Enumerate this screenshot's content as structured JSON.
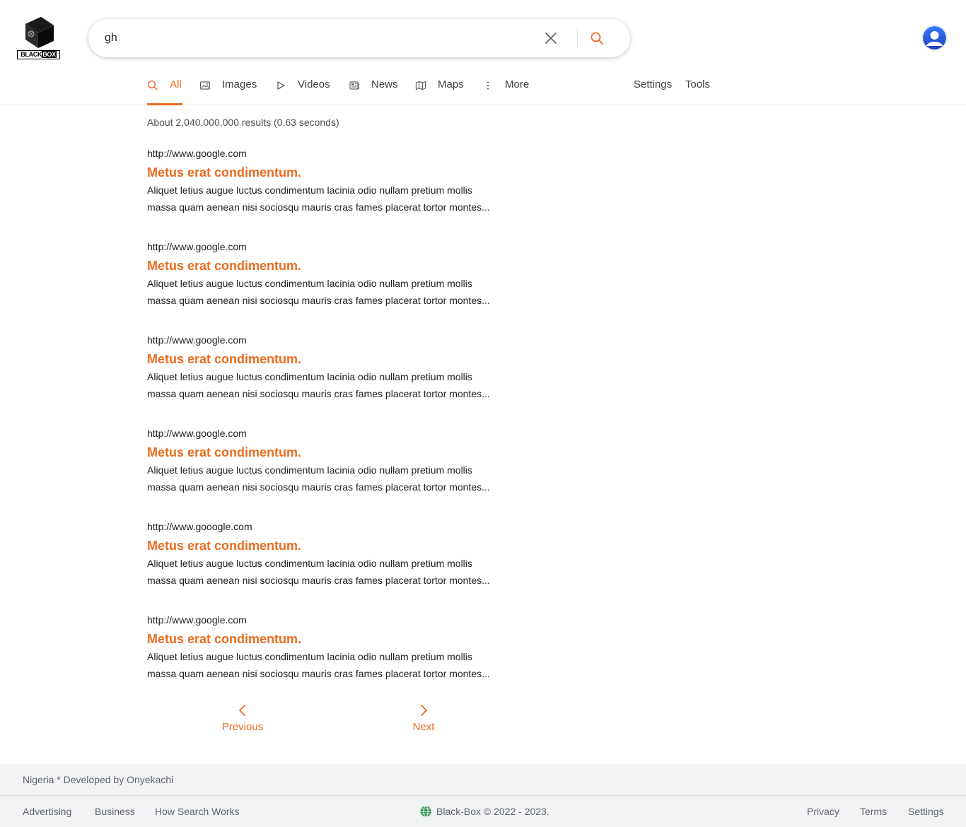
{
  "brand": {
    "logo_left": "BLACK",
    "logo_right": "BOX"
  },
  "search": {
    "query": "gh",
    "clear_icon": "close-icon",
    "search_icon": "search-icon"
  },
  "user": {
    "avatar_icon": "user-avatar-icon"
  },
  "tabs": [
    {
      "label": "All",
      "icon": "search-icon",
      "active": true
    },
    {
      "label": "Images",
      "icon": "image-icon",
      "active": false
    },
    {
      "label": "Videos",
      "icon": "play-icon",
      "active": false
    },
    {
      "label": "News",
      "icon": "newspaper-icon",
      "active": false
    },
    {
      "label": "Maps",
      "icon": "map-icon",
      "active": false
    },
    {
      "label": "More",
      "icon": "more-vert-icon",
      "active": false
    }
  ],
  "tools": {
    "settings": "Settings",
    "tools": "Tools"
  },
  "results_stats": "About 2,040,000,000 results (0.63 seconds)",
  "results": [
    {
      "url": "http://www.google.com",
      "title": "Metus erat condimentum.",
      "snippet_line1": "Aliquet letius augue luctus condimentum lacinia odio nullam pretium mollis",
      "snippet_line2": "massa quam aenean nisi sociosqu mauris cras fames placerat tortor montes..."
    },
    {
      "url": "http://www.google.com",
      "title": "Metus erat condimentum.",
      "snippet_line1": "Aliquet letius augue luctus condimentum lacinia odio nullam pretium mollis",
      "snippet_line2": "massa quam aenean nisi sociosqu mauris cras fames placerat tortor montes..."
    },
    {
      "url": "http://www.google.com",
      "title": "Metus erat condimentum.",
      "snippet_line1": "Aliquet letius augue luctus condimentum lacinia odio nullam pretium mollis",
      "snippet_line2": "massa quam aenean nisi sociosqu mauris cras fames placerat tortor montes..."
    },
    {
      "url": "http://www.google.com",
      "title": "Metus erat condimentum.",
      "snippet_line1": "Aliquet letius augue luctus condimentum lacinia odio nullam pretium mollis",
      "snippet_line2": "massa quam aenean nisi sociosqu mauris cras fames placerat tortor montes..."
    },
    {
      "url": "http://www.gooogle.com",
      "title": "Metus erat condimentum.",
      "snippet_line1": "Aliquet letius augue luctus condimentum lacinia odio nullam pretium mollis",
      "snippet_line2": "massa quam aenean nisi sociosqu mauris cras fames placerat tortor montes..."
    },
    {
      "url": "http://www.google.com",
      "title": "Metus erat condimentum.",
      "snippet_line1": "Aliquet letius augue luctus condimentum lacinia odio nullam pretium mollis",
      "snippet_line2": "massa quam aenean nisi sociosqu mauris cras fames placerat tortor montes..."
    }
  ],
  "pagination": {
    "previous": "Previous",
    "next": "Next"
  },
  "footer": {
    "location": "Nigeria * Developed by Onyekachi",
    "left_links": [
      "Advertising",
      "Business",
      "How Search Works"
    ],
    "copyright": "Black-Box © 2022 - 2023.",
    "right_links": [
      "Privacy",
      "Terms",
      "Settings"
    ]
  },
  "colors": {
    "accent": "#ea6c1f",
    "footer_bg": "#f2f3f5",
    "text": "#202124",
    "muted": "#5f6368"
  }
}
